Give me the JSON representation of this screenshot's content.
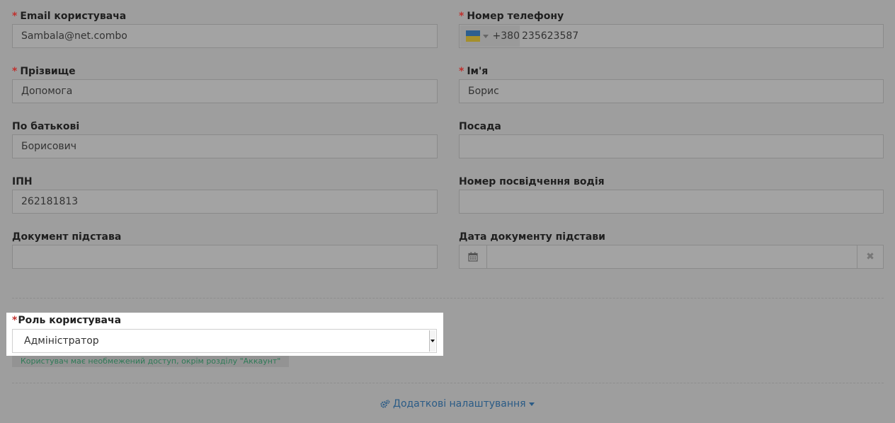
{
  "form": {
    "email": {
      "label": "Email користувача",
      "value": "Sambala@net.combo"
    },
    "phone": {
      "label": "Номер телефону",
      "dial_code": "+380",
      "value": "235623587"
    },
    "surname": {
      "label": "Прізвище",
      "value": "Допомога"
    },
    "first_name": {
      "label": "Ім'я",
      "value": "Борис"
    },
    "patronymic": {
      "label": "По батькові",
      "value": "Борисович"
    },
    "position": {
      "label": "Посада",
      "value": ""
    },
    "ipn": {
      "label": "ІПН",
      "value": "262181813"
    },
    "driver_license": {
      "label": "Номер посвідчення водія",
      "value": ""
    },
    "basis_document": {
      "label": "Документ підстава",
      "value": ""
    },
    "basis_document_date": {
      "label": "Дата документу підстави",
      "value": ""
    }
  },
  "role": {
    "label": "Роль користувача",
    "selected": "Адміністратор",
    "help": "Користувач має необмежений доступ, окрім розділу \"Аккаунт\""
  },
  "extra_settings": {
    "label": "Додаткові налаштування"
  },
  "required_mark": "*",
  "icons": {
    "flag": "ua-flag-icon",
    "calendar": "calendar-icon",
    "clear": "close-icon",
    "settings": "gears-icon"
  },
  "colors": {
    "required": "#c0302d",
    "help_text": "#2f7a57",
    "link": "#2a5b86",
    "flag_blue": "#2d5f8f",
    "flag_yellow": "#a58f2b"
  }
}
